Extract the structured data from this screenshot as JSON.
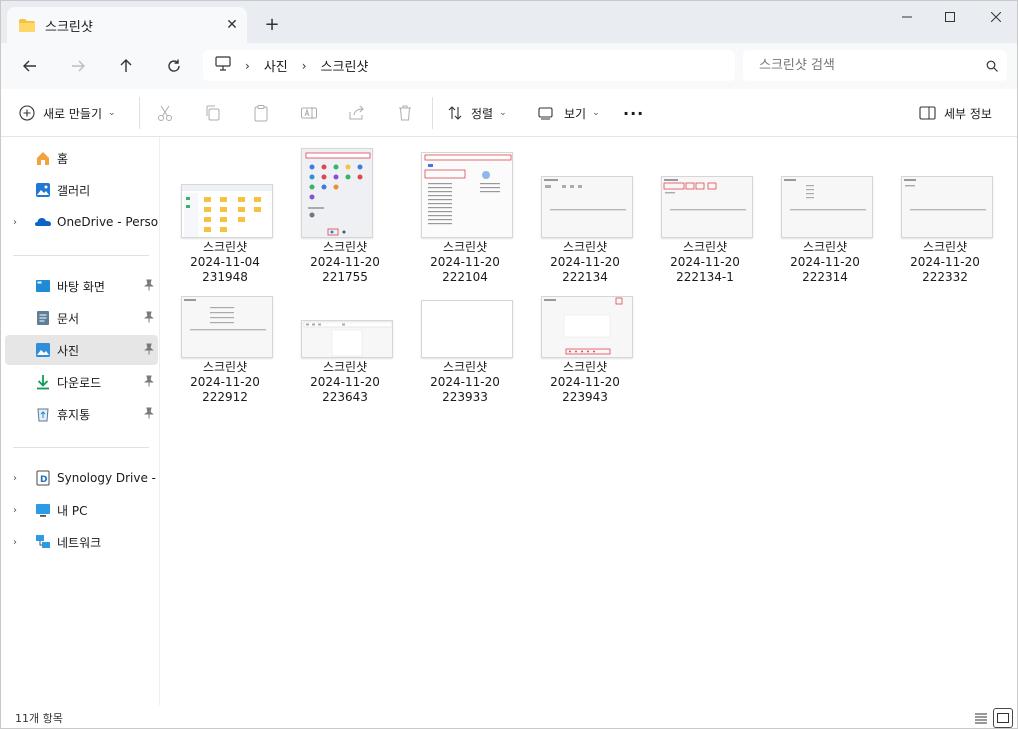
{
  "window": {
    "tab_title": "스크린샷",
    "new_tab": "+",
    "close_tab": "✕",
    "caption": {
      "minimize": "—",
      "maximize": "☐",
      "close": "✕"
    }
  },
  "navigation": {
    "breadcrumb": [
      "사진",
      "스크린샷"
    ],
    "separator": "›",
    "search_placeholder": "스크린샷 검색"
  },
  "command_bar": {
    "new_label": "새로 만들기",
    "sort_label": "정렬",
    "view_label": "보기",
    "more_label": "···",
    "details_label": "세부 정보"
  },
  "sidebar": {
    "quick": [
      {
        "label": "홈",
        "icon": "home-icon"
      },
      {
        "label": "갤러리",
        "icon": "gallery-icon"
      },
      {
        "label": "OneDrive - Persona",
        "icon": "onedrive-icon"
      }
    ],
    "pinned": [
      {
        "label": "바탕 화면",
        "icon": "desktop-icon"
      },
      {
        "label": "문서",
        "icon": "documents-icon"
      },
      {
        "label": "사진",
        "icon": "pictures-icon",
        "active": true
      },
      {
        "label": "다운로드",
        "icon": "downloads-icon"
      },
      {
        "label": "휴지통",
        "icon": "recycle-bin-icon"
      }
    ],
    "locations": [
      {
        "label": "Synology Drive - D",
        "icon": "synology-icon"
      },
      {
        "label": "내 PC",
        "icon": "pc-icon"
      },
      {
        "label": "네트워크",
        "icon": "network-icon"
      }
    ],
    "pin_glyph": "📌"
  },
  "files": [
    {
      "name": "스크린샷",
      "date": "2024-11-04",
      "time": "231948"
    },
    {
      "name": "스크린샷",
      "date": "2024-11-20",
      "time": "221755"
    },
    {
      "name": "스크린샷",
      "date": "2024-11-20",
      "time": "222104"
    },
    {
      "name": "스크린샷",
      "date": "2024-11-20",
      "time": "222134"
    },
    {
      "name": "스크린샷",
      "date": "2024-11-20",
      "time": "222134-1"
    },
    {
      "name": "스크린샷",
      "date": "2024-11-20",
      "time": "222314"
    },
    {
      "name": "스크린샷",
      "date": "2024-11-20",
      "time": "222332"
    },
    {
      "name": "스크린샷",
      "date": "2024-11-20",
      "time": "222912"
    },
    {
      "name": "스크린샷",
      "date": "2024-11-20",
      "time": "223643"
    },
    {
      "name": "스크린샷",
      "date": "2024-11-20",
      "time": "223933"
    },
    {
      "name": "스크린샷",
      "date": "2024-11-20",
      "time": "223943"
    }
  ],
  "status": {
    "item_count": "11개 항목"
  },
  "colors": {
    "accent": "#0067c0",
    "folder_yellow": "#f5c242",
    "thumb_red": "#e0474c"
  }
}
